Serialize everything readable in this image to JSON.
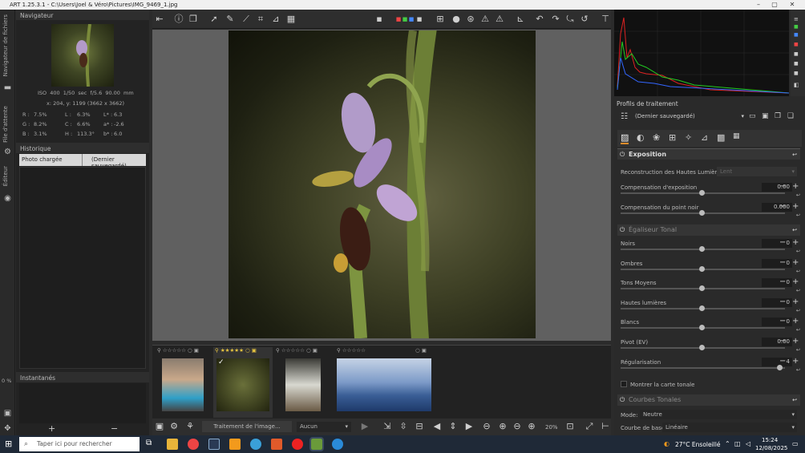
{
  "window": {
    "title": "ART 1.25.3.1 - C:\\Users\\Joel & Véro\\Pictures\\IMG_9469_1.jpg"
  },
  "left_tabs": [
    "Navigateur de fichiers",
    "File d'attente",
    "Éditeur"
  ],
  "left_pct": "0 %",
  "navigator": {
    "title": "Navigateur",
    "iso": "ISO 400",
    "shutter": "1/50 sec",
    "aperture": "f/5.6",
    "focal": "90.00 mm",
    "coords": "x: 204, y: 1199",
    "size": "(3662 x 3662)",
    "readouts": [
      [
        "R :",
        "7.5%",
        "L :",
        "6.3%",
        "L* :",
        "6.3"
      ],
      [
        "G :",
        "8.2%",
        "C :",
        "6.6%",
        "a* :",
        "-2.6"
      ],
      [
        "B :",
        "3.1%",
        "H :",
        "113.3°",
        "b* :",
        "6.0"
      ]
    ]
  },
  "history": {
    "title": "Historique",
    "rows": [
      {
        "action": "Photo chargée",
        "value": "(Dernier sauvegardé)"
      }
    ]
  },
  "snapshots": {
    "title": "Instantanés"
  },
  "bottombar": {
    "status": "Traitement de l'image...",
    "filter": "Aucun",
    "zoom": "20%"
  },
  "right": {
    "profiles_title": "Profils de traitement",
    "profile": "(Dernier sauvegardé)",
    "exposure": {
      "title": "Exposition",
      "hl_label": "Reconstruction des Hautes Lumières:",
      "hl_value": "Lent",
      "rows": [
        {
          "label": "Compensation d'exposition",
          "value": "0.00"
        },
        {
          "label": "Compensation du point noir",
          "value": "0.000"
        }
      ]
    },
    "tonal": {
      "title": "Égaliseur Tonal",
      "rows": [
        {
          "label": "Noirs",
          "value": "0"
        },
        {
          "label": "Ombres",
          "value": "0"
        },
        {
          "label": "Tons Moyens",
          "value": "0"
        },
        {
          "label": "Hautes lumières",
          "value": "0"
        },
        {
          "label": "Blancs",
          "value": "0"
        },
        {
          "label": "Pivot (EV)",
          "value": "0.00"
        },
        {
          "label": "Régularisation",
          "value": "4"
        }
      ],
      "show_map": "Montrer la carte tonale"
    },
    "curves": {
      "title": "Courbes Tonales",
      "mode_label": "Mode:",
      "mode_value": "Neutre",
      "base_label": "Courbe de base:",
      "base_value": "Linéaire"
    }
  },
  "taskbar": {
    "search_placeholder": "Taper ici pour rechercher",
    "weather": "27°C Ensoleillé",
    "time": "15:24",
    "date": "12/08/2025"
  }
}
